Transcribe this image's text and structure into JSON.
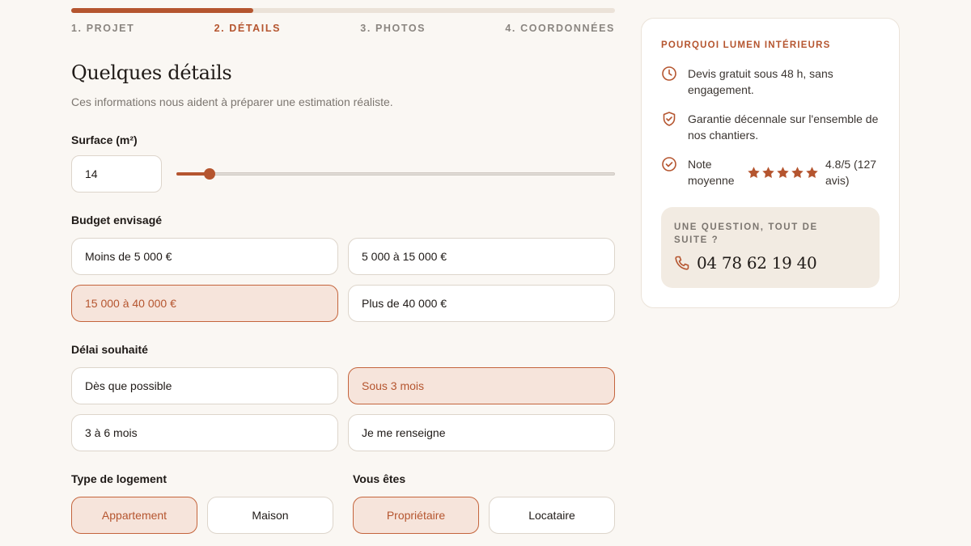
{
  "progress": {
    "percent": 33.5,
    "steps": [
      "1. PROJET",
      "2. DÉTAILS",
      "3. PHOTOS",
      "4. COORDONNÉES"
    ],
    "active_index": 1
  },
  "form": {
    "title": "Quelques détails",
    "subtitle": "Ces informations nous aident à préparer une estimation réaliste.",
    "surface": {
      "label": "Surface (m²)",
      "value": "14",
      "slider_fraction": 0.075
    },
    "budget": {
      "label": "Budget envisagé",
      "options": [
        "Moins de 5 000 €",
        "5 000 à 15 000 €",
        "15 000 à 40 000 €",
        "Plus de 40 000 €"
      ],
      "selected": "15 000 à 40 000 €"
    },
    "delai": {
      "label": "Délai souhaité",
      "options": [
        "Dès que possible",
        "Sous 3 mois",
        "3 à 6 mois",
        "Je me renseigne"
      ],
      "selected": "Sous 3 mois"
    },
    "logement": {
      "label": "Type de logement",
      "options": [
        "Appartement",
        "Maison"
      ],
      "selected": "Appartement"
    },
    "statut": {
      "label": "Vous êtes",
      "options": [
        "Propriétaire",
        "Locataire"
      ],
      "selected": "Propriétaire"
    }
  },
  "sidebar": {
    "title": "POURQUOI LUMEN INTÉRIEURS",
    "features": [
      {
        "icon": "clock-icon",
        "text": "Devis gratuit sous 48 h, sans engagement."
      },
      {
        "icon": "shield-check-icon",
        "text": "Garantie décennale sur l'ensemble de nos chantiers."
      }
    ],
    "rating": {
      "icon": "badge-check-icon",
      "label": "Note moyenne",
      "stars": 5,
      "value": "4.8/5 (127 avis)"
    },
    "contact": {
      "label": "UNE QUESTION, TOUT DE SUITE ?",
      "phone": "04 78 62 19 40",
      "icon": "phone-icon"
    }
  },
  "colors": {
    "accent": "#b5552f",
    "selected_bg": "#f6e4db",
    "background": "#faf7f3"
  }
}
